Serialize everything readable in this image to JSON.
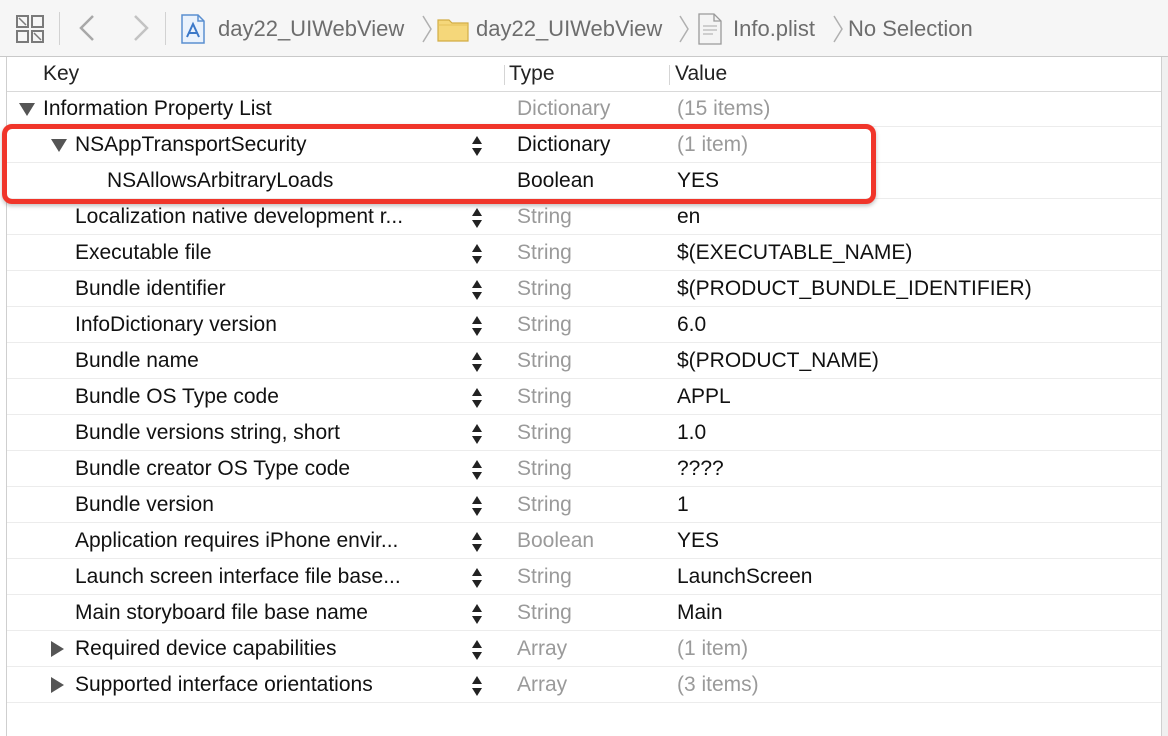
{
  "jumpbar": {
    "crumbs": [
      {
        "label": "day22_UIWebView",
        "icon": "project-icon"
      },
      {
        "label": "day22_UIWebView",
        "icon": "folder-icon"
      },
      {
        "label": "Info.plist",
        "icon": "plist-file-icon"
      },
      {
        "label": "No Selection",
        "icon": ""
      }
    ]
  },
  "table": {
    "headers": {
      "key": "Key",
      "type": "Type",
      "value": "Value"
    },
    "rows": [
      {
        "key": "Information Property List",
        "type": "Dictionary",
        "value": "(15 items)",
        "indent": 0,
        "disclosure": "down",
        "stepper": false
      },
      {
        "key": "NSAppTransportSecurity",
        "type": "Dictionary",
        "value": "(1 item)",
        "indent": 1,
        "disclosure": "down",
        "stepper": true
      },
      {
        "key": "NSAllowsArbitraryLoads",
        "type": "Boolean",
        "value": "YES",
        "indent": 2,
        "disclosure": "",
        "stepper": false
      },
      {
        "key": "Localization native development r...",
        "type": "String",
        "value": "en",
        "indent": 1,
        "disclosure": "",
        "stepper": true
      },
      {
        "key": "Executable file",
        "type": "String",
        "value": "$(EXECUTABLE_NAME)",
        "indent": 1,
        "disclosure": "",
        "stepper": true
      },
      {
        "key": "Bundle identifier",
        "type": "String",
        "value": "$(PRODUCT_BUNDLE_IDENTIFIER)",
        "indent": 1,
        "disclosure": "",
        "stepper": true
      },
      {
        "key": "InfoDictionary version",
        "type": "String",
        "value": "6.0",
        "indent": 1,
        "disclosure": "",
        "stepper": true
      },
      {
        "key": "Bundle name",
        "type": "String",
        "value": "$(PRODUCT_NAME)",
        "indent": 1,
        "disclosure": "",
        "stepper": true
      },
      {
        "key": "Bundle OS Type code",
        "type": "String",
        "value": "APPL",
        "indent": 1,
        "disclosure": "",
        "stepper": true
      },
      {
        "key": "Bundle versions string, short",
        "type": "String",
        "value": "1.0",
        "indent": 1,
        "disclosure": "",
        "stepper": true
      },
      {
        "key": "Bundle creator OS Type code",
        "type": "String",
        "value": "????",
        "indent": 1,
        "disclosure": "",
        "stepper": true
      },
      {
        "key": "Bundle version",
        "type": "String",
        "value": "1",
        "indent": 1,
        "disclosure": "",
        "stepper": true
      },
      {
        "key": "Application requires iPhone envir...",
        "type": "Boolean",
        "value": "YES",
        "indent": 1,
        "disclosure": "",
        "stepper": true
      },
      {
        "key": "Launch screen interface file base...",
        "type": "String",
        "value": "LaunchScreen",
        "indent": 1,
        "disclosure": "",
        "stepper": true
      },
      {
        "key": "Main storyboard file base name",
        "type": "String",
        "value": "Main",
        "indent": 1,
        "disclosure": "",
        "stepper": true
      },
      {
        "key": "Required device capabilities",
        "type": "Array",
        "value": "(1 item)",
        "indent": 1,
        "disclosure": "right",
        "stepper": true
      },
      {
        "key": "Supported interface orientations",
        "type": "Array",
        "value": "(3 items)",
        "indent": 1,
        "disclosure": "right",
        "stepper": true
      }
    ]
  },
  "colors": {
    "highlight": "#f0352a",
    "accent": "#3b82d6"
  }
}
